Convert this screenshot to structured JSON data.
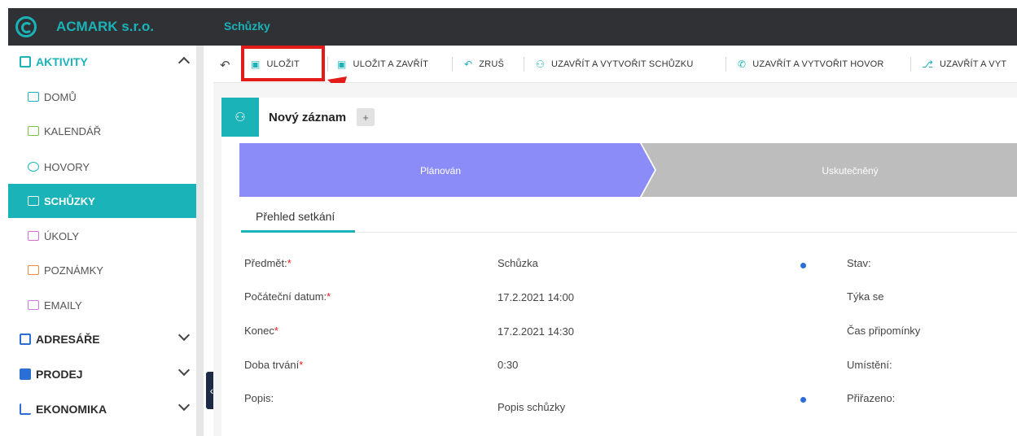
{
  "header": {
    "brand": "ACMARK s.r.o.",
    "page_title": "Schůzky"
  },
  "sidebar": {
    "sections": [
      {
        "label": "AKTIVITY",
        "expanded": true
      },
      {
        "label": "ADRESÁŘE",
        "expanded": false
      },
      {
        "label": "PRODEJ",
        "expanded": false
      },
      {
        "label": "EKONOMIKA",
        "expanded": false
      }
    ],
    "items": [
      {
        "label": "DOMŮ",
        "icon": "home-icon"
      },
      {
        "label": "KALENDÁŘ",
        "icon": "calendar-icon"
      },
      {
        "label": "HOVORY",
        "icon": "phone-icon"
      },
      {
        "label": "SCHŮZKY",
        "icon": "meeting-icon",
        "active": true
      },
      {
        "label": "ÚKOLY",
        "icon": "task-icon"
      },
      {
        "label": "POZNÁMKY",
        "icon": "note-icon"
      },
      {
        "label": "EMAILY",
        "icon": "email-icon"
      }
    ]
  },
  "toolbar": {
    "buttons": [
      {
        "label": "ULOŽIT",
        "icon": "save-icon"
      },
      {
        "label": "ULOŽIT A ZAVŘÍT",
        "icon": "save-icon"
      },
      {
        "label": "ZRUŠ",
        "icon": "undo-icon"
      },
      {
        "label": "UZAVŘÍT A VYTVOŘIT SCHŮZKU",
        "icon": "meeting-icon"
      },
      {
        "label": "UZAVŘÍT A VYTVOŘIT HOVOR",
        "icon": "phone-icon"
      },
      {
        "label": "UZAVŘÍT A VYT",
        "icon": "route-icon"
      }
    ]
  },
  "record": {
    "title": "Nový záznam",
    "add_label": "+"
  },
  "stages": [
    {
      "label": "Plánován",
      "active": true
    },
    {
      "label": "Uskutečněný",
      "active": false
    }
  ],
  "tabs": [
    {
      "label": "Přehled setkání"
    }
  ],
  "fields_left": [
    {
      "label": "Předmět:",
      "required_mark": "*",
      "value": "Schůzka"
    },
    {
      "label": "Počáteční datum:",
      "required_mark": "*",
      "value": "17.2.2021 14:00"
    },
    {
      "label": "Konec",
      "required_mark": "*",
      "value": "17.2.2021 14:30"
    },
    {
      "label": "Doba trvání",
      "required_mark": "*",
      "value": "0:30"
    },
    {
      "label": "Popis:",
      "required_mark": "",
      "value": "Popis schůzky"
    }
  ],
  "fields_right": [
    {
      "label": "Stav:"
    },
    {
      "label": "Týka se"
    },
    {
      "label": "Čas připomínky"
    },
    {
      "label": "Umístění:"
    },
    {
      "label": "Přiřazeno:"
    }
  ],
  "colors": {
    "accent": "#1ab3b8",
    "stage_active": "#8b8cf7",
    "stage_inactive": "#bdbdbd",
    "highlight": "#e31b1b",
    "topbar": "#2f3135"
  }
}
